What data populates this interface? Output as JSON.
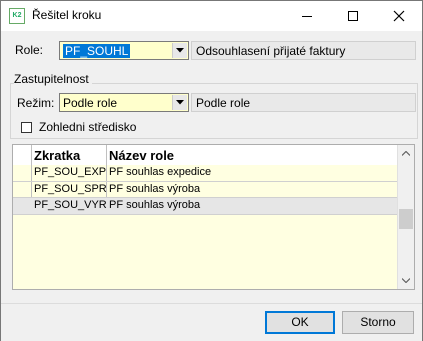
{
  "window": {
    "title": "Řešitel kroku",
    "icon_label": "K2"
  },
  "role": {
    "label": "Role:",
    "value": "PF_SOUHL",
    "description": "Odsouhlasení přijaté faktury"
  },
  "zastupitelnost": {
    "group_label": "Zastupitelnost",
    "rezim_label": "Režim:",
    "rezim_value": "Podle role",
    "rezim_description": "Podle role"
  },
  "stredisko": {
    "label": "Zohledni středisko",
    "checked": false
  },
  "grid": {
    "columns": [
      "Zkratka",
      "Název role"
    ],
    "rows": [
      {
        "zkratka": "PF_SOU_EXP",
        "nazev": "PF souhlas expedice"
      },
      {
        "zkratka": "PF_SOU_SPR",
        "nazev": "PF souhlas výroba"
      },
      {
        "zkratka": "PF_SOU_VYR",
        "nazev": "PF souhlas výroba"
      }
    ],
    "selected_row": 2
  },
  "buttons": {
    "ok": "OK",
    "cancel": "Storno"
  },
  "colors": {
    "input_bg": "#ffffcc",
    "selection": "#0078d7",
    "grid_bg": "#ffffe1"
  }
}
